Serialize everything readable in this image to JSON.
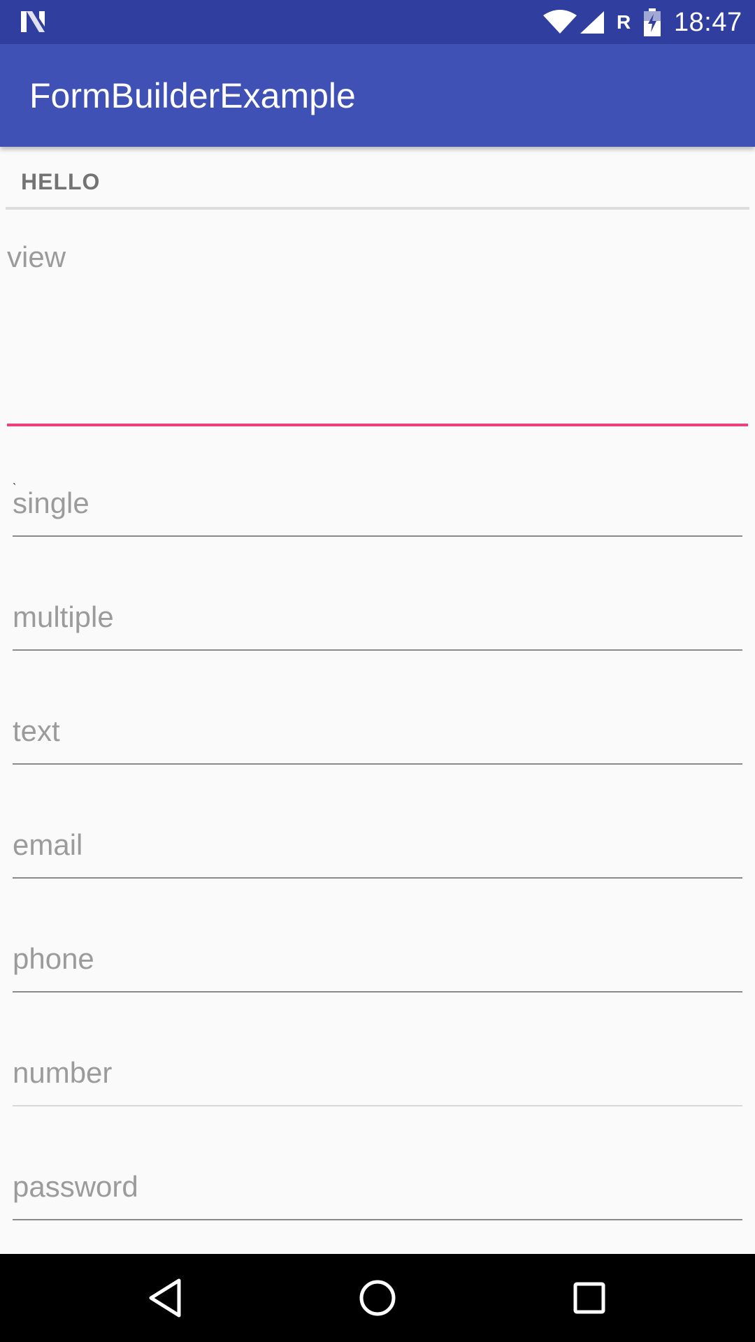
{
  "status_bar": {
    "time": "18:47",
    "roaming_indicator": "R",
    "icons": [
      "n-logo-icon",
      "wifi-icon",
      "signal-icon",
      "battery-charging-icon"
    ]
  },
  "app_bar": {
    "title": "FormBuilderExample"
  },
  "section": {
    "header": "HELLO"
  },
  "view_field": {
    "hint": "view",
    "accent_color": "#ec407a"
  },
  "fields": [
    {
      "hint": "single"
    },
    {
      "hint": "multiple"
    },
    {
      "hint": "text"
    },
    {
      "hint": "email"
    },
    {
      "hint": "phone"
    },
    {
      "hint": "number"
    },
    {
      "hint": "password"
    }
  ],
  "nav_bar": {
    "buttons": [
      "back-icon",
      "home-icon",
      "recents-icon"
    ]
  },
  "colors": {
    "status_bar": "#303f9f",
    "app_bar": "#3f51b5",
    "accent": "#ec407a",
    "background": "#fafafa"
  }
}
